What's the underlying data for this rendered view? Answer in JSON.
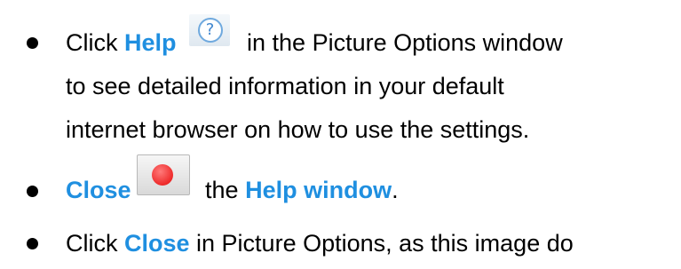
{
  "items": [
    {
      "line1_before": "Click ",
      "line1_hl": "Help",
      "line1_after": " in the Picture Options window",
      "line2": "to see detailed information in your default",
      "line3": "internet browser on how to use the settings.",
      "icon": "help-question-icon"
    },
    {
      "hl1": "Close",
      "mid": " the ",
      "hl2": "Help window",
      "end": ".",
      "icon": "close-red-button-icon"
    },
    {
      "before": "Click ",
      "hl": "Close",
      "after": " in Picture Options, as this image do"
    }
  ],
  "colors": {
    "highlight": "#1f8fe0",
    "text": "#000000",
    "close_dot": "#ee2a2a",
    "help_ring": "#6fa9de"
  }
}
